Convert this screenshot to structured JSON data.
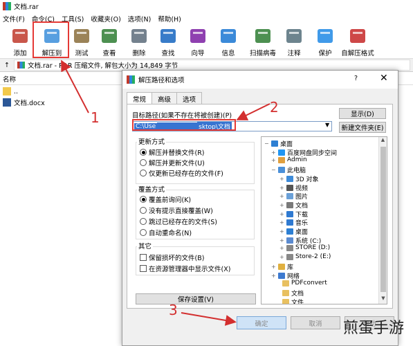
{
  "window": {
    "title": "文档.rar"
  },
  "menu": [
    "文件(F)",
    "命令(C)",
    "工具(S)",
    "收藏夹(O)",
    "选项(N)",
    "帮助(H)"
  ],
  "toolbar": [
    {
      "label": "添加",
      "icon": "books-icon",
      "color": "#c0392b"
    },
    {
      "label": "解压到",
      "icon": "folder-icon",
      "color": "#3b8edb"
    },
    {
      "label": "测试",
      "icon": "clipboard-check-icon",
      "color": "#8a6d3b"
    },
    {
      "label": "查看",
      "icon": "book-icon",
      "color": "#2e7d32"
    },
    {
      "label": "删除",
      "icon": "trash-icon",
      "color": "#5c6b7a"
    },
    {
      "label": "查找",
      "icon": "magnifier-icon",
      "color": "#1565c0"
    },
    {
      "label": "向导",
      "icon": "wand-icon",
      "color": "#7b1fa2"
    },
    {
      "label": "信息",
      "icon": "info-icon",
      "color": "#1976d2"
    },
    {
      "label": "扫描病毒",
      "icon": "bug-icon",
      "color": "#2e7d32"
    },
    {
      "label": "注释",
      "icon": "comment-icon",
      "color": "#546e7a"
    },
    {
      "label": "保护",
      "icon": "shield-icon",
      "color": "#1e88e5"
    },
    {
      "label": "自解压格式",
      "icon": "sfx-books-icon",
      "color": "#c62828"
    }
  ],
  "address": {
    "text": "文档.rar - RAR 压缩文件, 解包大小为 14,849 字节"
  },
  "filelist": {
    "column": "名称",
    "items": [
      {
        "name": ".."
      },
      {
        "name": "文档.docx"
      }
    ]
  },
  "dialog": {
    "title": "解压路径和选项",
    "help": "?",
    "close": "✕",
    "tabs": [
      "常规",
      "高级",
      "选项"
    ],
    "dest_label": "目标路径(如果不存在将被创建)(P)",
    "dest_value_pre": "C:\\Use",
    "dest_value_post": "sktop\\文档",
    "show_button": "显示(D)",
    "new_folder_button": "新建文件夹(E)",
    "update_group": {
      "label": "更新方式",
      "options": [
        {
          "text": "解压并替换文件(R)",
          "checked": true
        },
        {
          "text": "解压并更新文件(U)",
          "checked": false
        },
        {
          "text": "仅更新已经存在的文件(F)",
          "checked": false
        }
      ]
    },
    "overwrite_group": {
      "label": "覆盖方式",
      "options": [
        {
          "text": "覆盖前询问(K)",
          "checked": true
        },
        {
          "text": "没有提示直接覆盖(W)",
          "checked": false
        },
        {
          "text": "跳过已经存在的文件(S)",
          "checked": false
        },
        {
          "text": "自动重命名(N)",
          "checked": false
        }
      ]
    },
    "other_group": {
      "label": "其它",
      "options": [
        {
          "text": "保留损坏的文件(B)",
          "checked": false
        },
        {
          "text": "在资源管理器中显示文件(X)",
          "checked": false
        }
      ]
    },
    "save_button": "保存设置(V)",
    "tree": [
      {
        "text": "桌面",
        "icon": "desktop-icon",
        "color": "#2d7fd3",
        "expander": "−"
      },
      {
        "text": "百度网盘同步空间",
        "icon": "cloud-icon",
        "color": "#2196f3",
        "expander": "+"
      },
      {
        "text": "Admin",
        "icon": "user-icon",
        "color": "#e0a040",
        "expander": "+"
      },
      {
        "text": "此电脑",
        "icon": "computer-icon",
        "color": "#4a90d9",
        "expander": "−"
      },
      {
        "text": "3D 对象",
        "icon": "cube-icon",
        "color": "#3d8bd9",
        "expander": "+"
      },
      {
        "text": "视频",
        "icon": "video-icon",
        "color": "#555555",
        "expander": "+"
      },
      {
        "text": "图片",
        "icon": "picture-icon",
        "color": "#6aa0d8",
        "expander": "+"
      },
      {
        "text": "文档",
        "icon": "document-icon",
        "color": "#7a7a7a",
        "expander": "+"
      },
      {
        "text": "下载",
        "icon": "download-icon",
        "color": "#2f7ad1",
        "expander": "+"
      },
      {
        "text": "音乐",
        "icon": "music-icon",
        "color": "#2f7ad1",
        "expander": "+"
      },
      {
        "text": "桌面",
        "icon": "desktop-icon",
        "color": "#2d7fd3",
        "expander": "+"
      },
      {
        "text": "系统 (C:)",
        "icon": "drive-icon",
        "color": "#5b8bd0",
        "expander": "+"
      },
      {
        "text": "STORE (D:)",
        "icon": "drive-icon",
        "color": "#888888",
        "expander": "+"
      },
      {
        "text": "Store-2 (E:)",
        "icon": "drive-icon",
        "color": "#888888",
        "expander": "+"
      },
      {
        "text": "库",
        "icon": "library-icon",
        "color": "#e0b040",
        "expander": "+"
      },
      {
        "text": "网络",
        "icon": "network-icon",
        "color": "#3d7ad0",
        "expander": "+"
      },
      {
        "text": "PDFconvert",
        "icon": "folder-icon",
        "color": "#e8c060",
        "expander": ""
      },
      {
        "text": "文档",
        "icon": "folder-icon",
        "color": "#e8c060",
        "expander": ""
      },
      {
        "text": "文件",
        "icon": "folder-icon",
        "color": "#e8c060",
        "expander": ""
      }
    ],
    "ok_button": "确定",
    "cancel_button": "取消",
    "help_button": "帮助"
  },
  "annotations": {
    "num1": "1",
    "num2": "2",
    "num3": "3",
    "color": "#d32f2f"
  },
  "watermark": "煎蛋手游"
}
